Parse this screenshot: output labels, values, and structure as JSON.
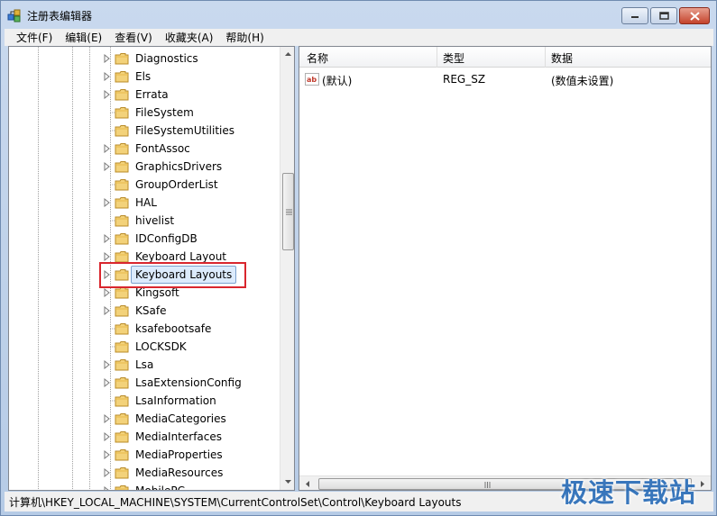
{
  "window": {
    "title": "注册表编辑器"
  },
  "menu": [
    "文件(F)",
    "编辑(E)",
    "查看(V)",
    "收藏夹(A)",
    "帮助(H)"
  ],
  "tree": {
    "items": [
      {
        "label": "Diagnostics",
        "expandable": true
      },
      {
        "label": "Els",
        "expandable": true
      },
      {
        "label": "Errata",
        "expandable": true
      },
      {
        "label": "FileSystem",
        "expandable": false
      },
      {
        "label": "FileSystemUtilities",
        "expandable": false
      },
      {
        "label": "FontAssoc",
        "expandable": true
      },
      {
        "label": "GraphicsDrivers",
        "expandable": true
      },
      {
        "label": "GroupOrderList",
        "expandable": false
      },
      {
        "label": "HAL",
        "expandable": true
      },
      {
        "label": "hivelist",
        "expandable": false
      },
      {
        "label": "IDConfigDB",
        "expandable": true
      },
      {
        "label": "Keyboard Layout",
        "expandable": true
      },
      {
        "label": "Keyboard Layouts",
        "expandable": true,
        "selected": true
      },
      {
        "label": "Kingsoft",
        "expandable": true
      },
      {
        "label": "KSafe",
        "expandable": true
      },
      {
        "label": "ksafebootsafe",
        "expandable": false
      },
      {
        "label": "LOCKSDK",
        "expandable": false
      },
      {
        "label": "Lsa",
        "expandable": true
      },
      {
        "label": "LsaExtensionConfig",
        "expandable": true
      },
      {
        "label": "LsaInformation",
        "expandable": false
      },
      {
        "label": "MediaCategories",
        "expandable": true
      },
      {
        "label": "MediaInterfaces",
        "expandable": true
      },
      {
        "label": "MediaProperties",
        "expandable": true
      },
      {
        "label": "MediaResources",
        "expandable": true
      },
      {
        "label": "MobilePC",
        "expandable": true
      }
    ]
  },
  "list": {
    "columns": [
      "名称",
      "类型",
      "数据"
    ],
    "rows": [
      {
        "name": "(默认)",
        "type": "REG_SZ",
        "data": "(数值未设置)",
        "icon": "string-value-icon"
      }
    ]
  },
  "status": {
    "path": "计算机\\HKEY_LOCAL_MACHINE\\SYSTEM\\CurrentControlSet\\Control\\Keyboard Layouts"
  },
  "watermark": "极速下载站",
  "colors": {
    "highlight_border": "#d9262e",
    "selection_bg": "#dcebfc",
    "watermark": "#2a6db8"
  }
}
